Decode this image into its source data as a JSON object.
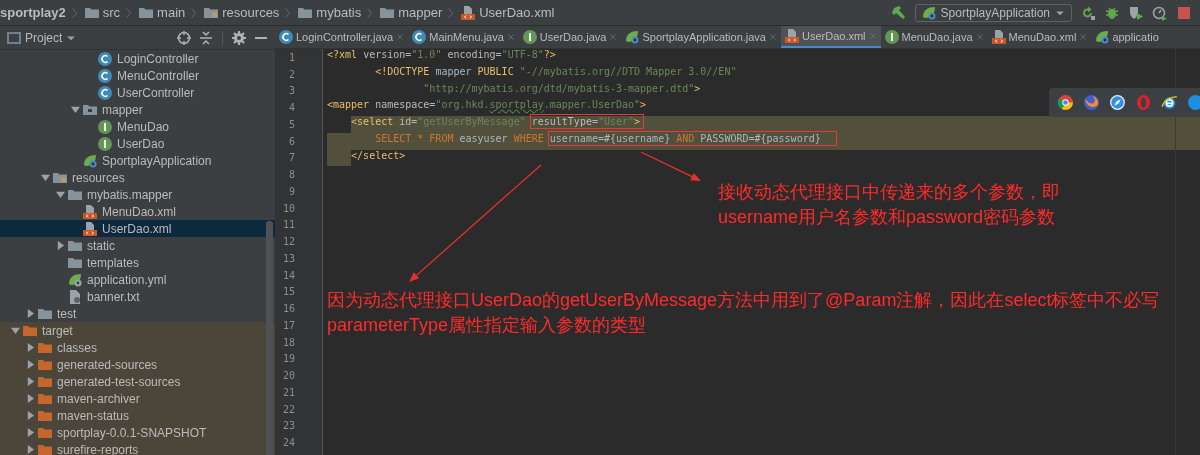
{
  "breadcrumb": [
    {
      "label": "sportplay2",
      "kind": "project"
    },
    {
      "label": "src",
      "kind": "folder"
    },
    {
      "label": "main",
      "kind": "folder"
    },
    {
      "label": "resources",
      "kind": "resources"
    },
    {
      "label": "mybatis",
      "kind": "folder"
    },
    {
      "label": "mapper",
      "kind": "folder"
    },
    {
      "label": "UserDao.xml",
      "kind": "xml"
    }
  ],
  "toolbar": {
    "run_config": "SportplayApplication"
  },
  "project_panel": {
    "title": "Project",
    "tree": [
      {
        "children": [
          {
            "children": [
              {
                "children": [
                  {
                    "children": [
                      {
                        "children": [
                          {
                            "label": "LoginController",
                            "kind": "class",
                            "selected": false
                          },
                          {
                            "label": "MenuController",
                            "kind": "class",
                            "selected": false
                          },
                          {
                            "label": "UserController",
                            "kind": "class",
                            "selected": false
                          }
                        ]
                      },
                      {
                        "label": "mapper",
                        "kind": "package",
                        "expanded": true,
                        "selected": false,
                        "children": [
                          {
                            "label": "MenuDao",
                            "kind": "interface",
                            "selected": false
                          },
                          {
                            "label": "UserDao",
                            "kind": "interface",
                            "selected": false
                          }
                        ]
                      },
                      {
                        "label": "SportplayApplication",
                        "kind": "spring",
                        "selected": false
                      }
                    ]
                  }
                ]
              },
              {
                "label": "resources",
                "kind": "resources",
                "expanded": true,
                "selected": false,
                "children": [
                  {
                    "label": "mybatis.mapper",
                    "kind": "folder",
                    "expanded": true,
                    "selected": false,
                    "children": [
                      {
                        "label": "MenuDao.xml",
                        "kind": "xml",
                        "selected": false
                      },
                      {
                        "label": "UserDao.xml",
                        "kind": "xml",
                        "selected": true
                      }
                    ]
                  },
                  {
                    "label": "static",
                    "kind": "folder",
                    "expanded": false,
                    "selected": false
                  },
                  {
                    "label": "templates",
                    "kind": "folder",
                    "selected": false
                  },
                  {
                    "label": "application.yml",
                    "kind": "yml",
                    "selected": false
                  },
                  {
                    "label": "banner.txt",
                    "kind": "txt",
                    "selected": false
                  }
                ]
              }
            ]
          },
          {
            "label": "test",
            "kind": "folder",
            "expanded": false,
            "selected": false
          }
        ]
      },
      {
        "label": "target",
        "kind": "folder",
        "expanded": true,
        "excluded": true,
        "selected": false,
        "children": [
          {
            "label": "classes",
            "kind": "folder",
            "expanded": false,
            "selected": false
          },
          {
            "label": "generated-sources",
            "kind": "folder",
            "expanded": false,
            "selected": false
          },
          {
            "label": "generated-test-sources",
            "kind": "folder",
            "expanded": false,
            "selected": false
          },
          {
            "label": "maven-archiver",
            "kind": "folder",
            "expanded": false,
            "selected": false
          },
          {
            "label": "maven-status",
            "kind": "folder",
            "expanded": false,
            "selected": false
          },
          {
            "label": "sportplay-0.0.1-SNAPSHOT",
            "kind": "folder",
            "expanded": false,
            "selected": false
          },
          {
            "label": "surefire-reports",
            "kind": "folder",
            "expanded": false,
            "selected": false
          }
        ]
      }
    ]
  },
  "editor": {
    "tabs": [
      {
        "label": "LoginController.java",
        "kind": "class",
        "selected": false
      },
      {
        "label": "MainMenu.java",
        "kind": "class",
        "selected": false
      },
      {
        "label": "UserDao.java",
        "kind": "interface",
        "selected": false
      },
      {
        "label": "SportplayApplication.java",
        "kind": "spring",
        "selected": false
      },
      {
        "label": "UserDao.xml",
        "kind": "xml",
        "selected": true
      },
      {
        "label": "MenuDao.java",
        "kind": "interface",
        "selected": false
      },
      {
        "label": "MenuDao.xml",
        "kind": "xml",
        "selected": false
      },
      {
        "label": "applicatio",
        "kind": "spring",
        "selected": false
      }
    ],
    "lines": [
      {
        "number": "1",
        "kind": "root",
        "selected": false,
        "segments": [
          {
            "kind": "tag",
            "text": "<?xml "
          },
          {
            "kind": "attr",
            "text": "version"
          },
          {
            "kind": "plain",
            "text": "="
          },
          {
            "kind": "string",
            "text": "\"1.0\" "
          },
          {
            "kind": "attr",
            "text": "encoding"
          },
          {
            "kind": "plain",
            "text": "="
          },
          {
            "kind": "string",
            "text": "\"UTF-8\""
          },
          {
            "kind": "tag",
            "text": "?>"
          }
        ]
      },
      {
        "number": "2",
        "kind": "continuation",
        "selected": false,
        "segments": [
          {
            "kind": "tag",
            "text": "<!DOCTYPE "
          },
          {
            "kind": "plain",
            "text": "mapper "
          },
          {
            "kind": "tag",
            "text": "PUBLIC "
          },
          {
            "kind": "string",
            "text": "\"-//mybatis.org//DTD Mapper 3.0//EN\""
          }
        ]
      },
      {
        "number": "3",
        "kind": "continuation2",
        "selected": false,
        "segments": [
          {
            "kind": "string",
            "text": "\"http://mybatis.org/dtd/mybatis-3-mapper.dtd\""
          },
          {
            "kind": "tag",
            "text": ">"
          }
        ]
      },
      {
        "number": "4",
        "kind": "root",
        "selected": false,
        "segments": [
          {
            "kind": "tag",
            "text": "<mapper "
          },
          {
            "kind": "attr",
            "text": "namespace"
          },
          {
            "kind": "plain",
            "text": "="
          },
          {
            "kind": "string",
            "text": "\"org.hkd."
          },
          {
            "kind": "typo",
            "text": "sportplay"
          },
          {
            "kind": "string",
            "text": ".mapper.UserDao\""
          },
          {
            "kind": "tag",
            "text": ">"
          }
        ]
      },
      {
        "number": "5",
        "kind": "child",
        "selected": true,
        "segments": [
          {
            "kind": "tag",
            "text": "<select "
          },
          {
            "kind": "attr",
            "text": "id"
          },
          {
            "kind": "plain",
            "text": "="
          },
          {
            "kind": "string",
            "text": "\"getUserByMessage\" "
          },
          {
            "kind": "box",
            "parts": [
              {
                "kind": "attr",
                "text": "resultType"
              },
              {
                "kind": "plain",
                "text": "="
              },
              {
                "kind": "string",
                "text": "\"User\""
              },
              {
                "kind": "tag",
                "text": ">"
              }
            ]
          }
        ]
      },
      {
        "number": "6",
        "kind": "grandchild",
        "selected": true,
        "segments": [
          {
            "kind": "keyword",
            "text": "SELECT * FROM "
          },
          {
            "kind": "plain",
            "text": "easyuser "
          },
          {
            "kind": "keyword",
            "text": "WHERE "
          },
          {
            "kind": "box",
            "parts": [
              {
                "kind": "plain",
                "text": "username=#{username} "
              },
              {
                "kind": "keyword",
                "text": "AND "
              },
              {
                "kind": "plain",
                "text": "PASSWORD=#{password}"
              }
            ]
          }
        ]
      },
      {
        "number": "7",
        "kind": "child",
        "selected": true,
        "segments": [
          {
            "kind": "tag",
            "text": "</select>"
          }
        ]
      },
      {
        "number": "8",
        "selected": false
      },
      {
        "number": "9",
        "selected": false
      },
      {
        "number": "10",
        "selected": false
      },
      {
        "number": "11",
        "selected": false
      },
      {
        "number": "12",
        "selected": false
      },
      {
        "number": "13",
        "selected": false
      },
      {
        "number": "14",
        "selected": false
      },
      {
        "number": "15",
        "selected": false
      },
      {
        "number": "16",
        "selected": false
      },
      {
        "number": "17",
        "selected": false
      },
      {
        "number": "18",
        "selected": false
      },
      {
        "number": "19",
        "selected": false
      },
      {
        "number": "20",
        "selected": false
      },
      {
        "number": "21",
        "selected": false
      },
      {
        "number": "22",
        "selected": false
      },
      {
        "number": "23",
        "selected": false
      },
      {
        "number": "24",
        "selected": false
      }
    ],
    "annotations": [
      {
        "text": "接收动态代理接口中传递来的多个参数，即username用户名参数和password密码参数"
      },
      {
        "text": "因为动态代理接口UserDao的getUserByMessage方法中用到了@Param注解，因此在select标签中不必写parameterType属性指定输入参数的类型"
      }
    ]
  }
}
